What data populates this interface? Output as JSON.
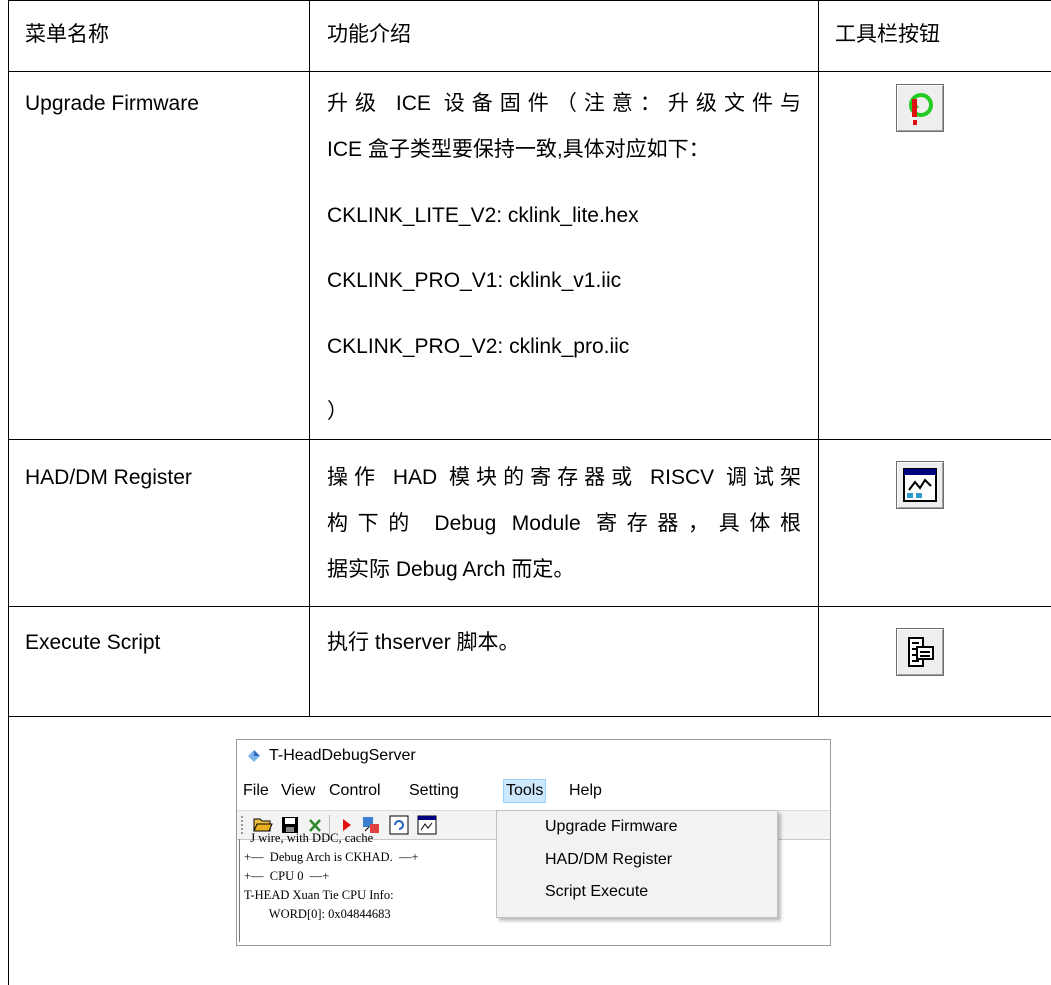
{
  "table": {
    "headers": [
      "菜单名称",
      "功能介绍",
      "工具栏按钮"
    ],
    "rows": [
      {
        "menu": "Upgrade Firmware",
        "desc_lines": [
          "升级 ICE 设备固件（注意：升级文件与",
          "ICE 盒子类型要保持一致,具体对应如下：",
          "CKLINK_LITE_V2: cklink_lite.hex",
          "CKLINK_PRO_V1: cklink_v1.iic",
          "CKLINK_PRO_V2: cklink_pro.iic",
          "）"
        ],
        "icon": "upgrade-firmware-icon"
      },
      {
        "menu": "HAD/DM Register",
        "desc_lines": [
          "操作 HAD 模块的寄存器或 RISCV 调试架",
          "构下的 Debug Module 寄存器，具体根",
          "据实际 Debug Arch 而定。"
        ],
        "icon": "register-window-icon"
      },
      {
        "menu": "Execute Script",
        "desc_lines": [
          "执行 thserver 脚本。"
        ],
        "icon": "script-icon"
      }
    ]
  },
  "app": {
    "title": "T-HeadDebugServer",
    "menubar": [
      "File",
      "View",
      "Control",
      "Setting",
      "Tools",
      "Help"
    ],
    "selected_menu": "Tools",
    "tools_menu_items": [
      "Upgrade Firmware",
      "HAD/DM Register",
      "Script Execute"
    ],
    "console_lines": [
      "  J wire, with DDC, cache",
      "+—  Debug Arch is CKHAD.  —+",
      "+—  CPU 0  —+",
      "T-HEAD Xuan Tie CPU Info:",
      "        WORD[0]: 0x04844683"
    ],
    "colors": {
      "menu_highlight": "#cce8ff",
      "icon_green": "#22cc22",
      "icon_red": "#dd1111"
    }
  }
}
